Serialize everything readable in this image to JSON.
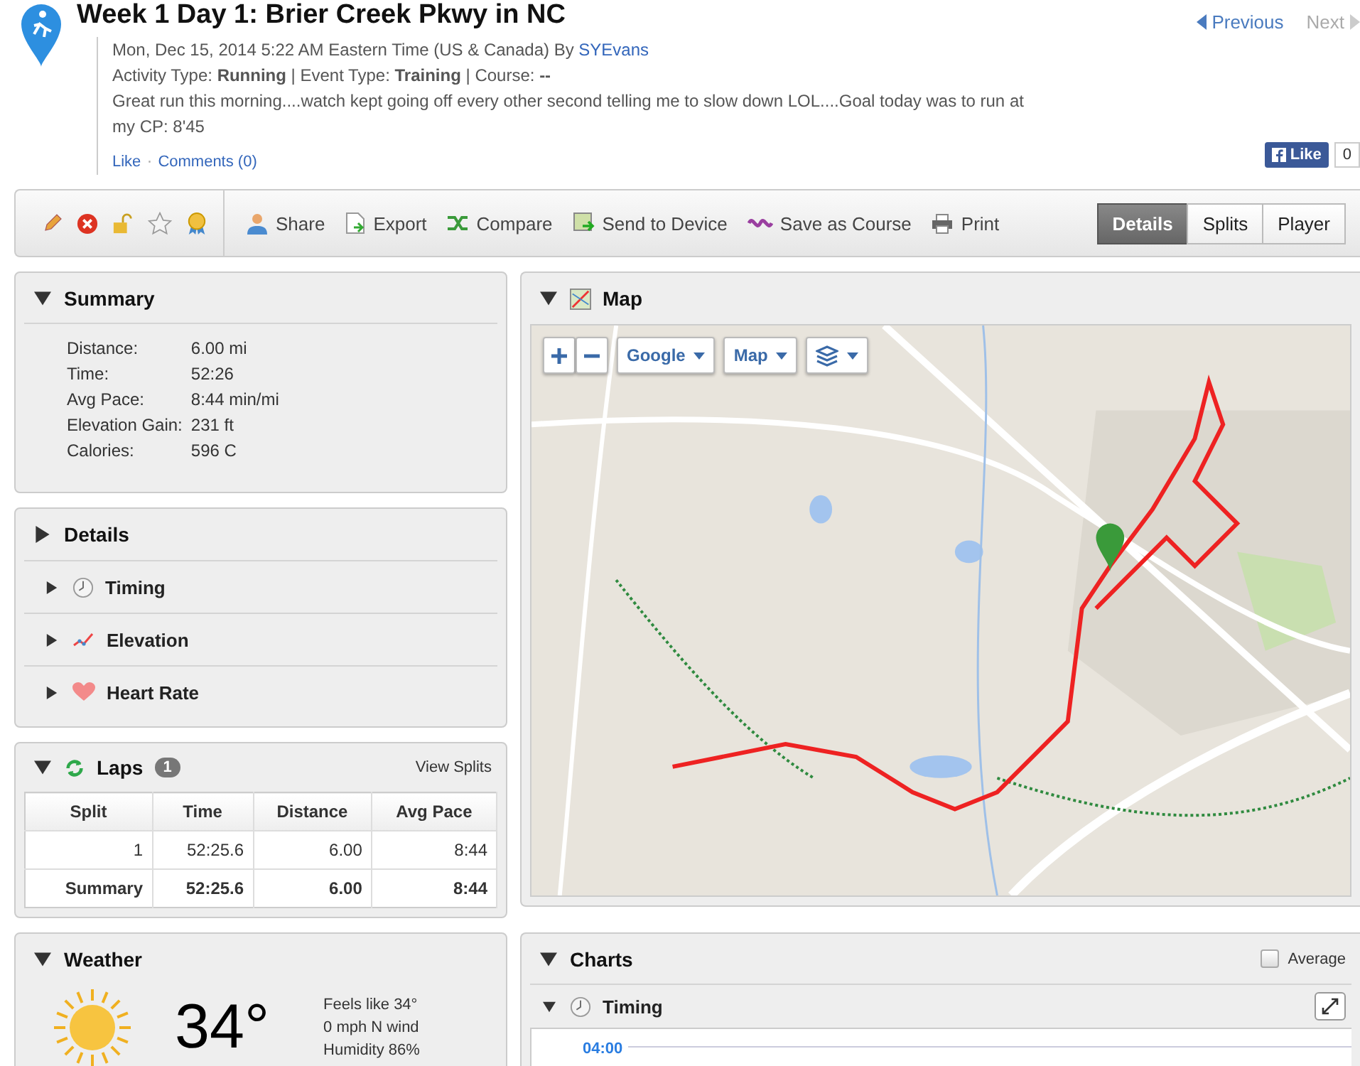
{
  "header": {
    "title": "Week 1 Day 1: Brier Creek Pkwy in NC",
    "meta": "Mon, Dec 15, 2014 5:22 AM Eastern Time (US & Canada) By",
    "author": "SYEvans",
    "activity": "Activity Type: **Running** | Event Type: **Training** | Course: **--**",
    "description": "Great run this morning....watch kept going off every other second telling me to slow down LOL....Goal today was to run at my CP: 8'45",
    "links": [
      {
        "label": "Like"
      },
      {
        "label": "Comments (0)"
      }
    ],
    "link_separator": "·",
    "nav": [
      {
        "label": "Previous",
        "disabled": false,
        "kind": "prev"
      },
      {
        "label": "Next",
        "disabled": true,
        "kind": "next"
      }
    ],
    "fb_like": {
      "label": "Like",
      "count": "0"
    }
  },
  "toolbar": {
    "icon_buttons": [
      {
        "kind": "edit"
      },
      {
        "kind": "delete"
      },
      {
        "kind": "lock"
      },
      {
        "kind": "star"
      },
      {
        "kind": "award"
      }
    ],
    "actions": [
      {
        "label": "Share",
        "kind": "share"
      },
      {
        "label": "Export",
        "kind": "export"
      },
      {
        "label": "Compare",
        "kind": "compare"
      },
      {
        "label": "Send to Device",
        "kind": "send"
      },
      {
        "label": "Save as Course",
        "kind": "course"
      },
      {
        "label": "Print",
        "kind": "print"
      }
    ],
    "views": [
      {
        "label": "Details",
        "selected": true
      },
      {
        "label": "Splits",
        "selected": false
      },
      {
        "label": "Player",
        "selected": false
      }
    ]
  },
  "summary": {
    "title": "Summary",
    "expanded": true,
    "stats": [
      {
        "label": "Distance:",
        "value": "6.00 mi"
      },
      {
        "label": "Time:",
        "value": "52:26"
      },
      {
        "label": "Avg Pace:",
        "value": "8:44 min/mi"
      },
      {
        "label": "Elevation Gain:",
        "value": "231 ft"
      },
      {
        "label": "Calories:",
        "value": "596 C"
      }
    ]
  },
  "details": {
    "title": "Details",
    "expanded": false,
    "items": [
      {
        "label": "Timing",
        "kind": "timing",
        "expanded": false
      },
      {
        "label": "Elevation",
        "kind": "elevation",
        "expanded": false
      },
      {
        "label": "Heart Rate",
        "kind": "heart",
        "expanded": false
      }
    ]
  },
  "laps": {
    "title": "Laps",
    "count": "1",
    "expanded": true,
    "link": "View Splits",
    "columns": [
      "Split",
      "Time",
      "Distance",
      "Avg Pace"
    ],
    "rows": [
      {
        "kind": "lap",
        "cells": [
          "1",
          "52:25.6",
          "6.00",
          "8:44"
        ]
      },
      {
        "kind": "summary",
        "cells": [
          "Summary",
          "52:25.6",
          "6.00",
          "8:44"
        ]
      }
    ]
  },
  "weather": {
    "title": "Weather",
    "expanded": true,
    "temperature": "34°",
    "details": [
      "Feels like 34°",
      "0 mph N wind",
      "Humidity 86%"
    ]
  },
  "map": {
    "title": "Map",
    "expanded": true,
    "provider": "Google",
    "map_type": "Map"
  },
  "charts": {
    "title": "Charts",
    "expanded": true,
    "average": {
      "label": "Average",
      "checked": false
    },
    "sections": [
      {
        "title": "Timing",
        "expanded": true,
        "axis_label": "04:00"
      }
    ]
  }
}
